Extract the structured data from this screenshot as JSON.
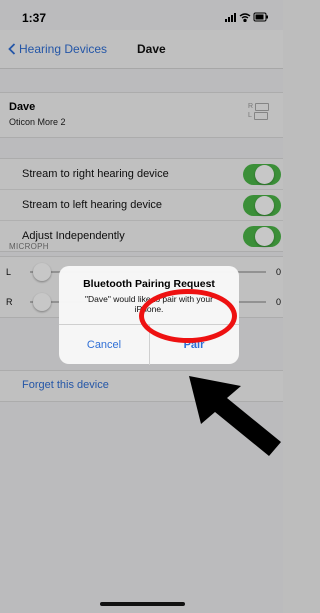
{
  "status_bar": {
    "time": "1:37"
  },
  "nav": {
    "back_label": "Hearing Devices",
    "title": "Dave"
  },
  "device": {
    "name": "Dave",
    "model": "Oticon More 2",
    "right_label": "R",
    "left_label": "L"
  },
  "toggles": [
    {
      "label": "Stream to right hearing device",
      "on": true
    },
    {
      "label": "Stream to left hearing device",
      "on": true
    },
    {
      "label": "Adjust Independently",
      "on": true
    }
  ],
  "mic": {
    "section_label": "MICROPH",
    "rows": [
      {
        "label": "L",
        "value": "0"
      },
      {
        "label": "R",
        "value": "0"
      }
    ]
  },
  "forget_label": "Forget this device",
  "alert": {
    "title": "Bluetooth Pairing Request",
    "message": "\"Dave\" would like to pair with your iPhone.",
    "cancel_label": "Cancel",
    "pair_label": "Pair"
  },
  "colors": {
    "accent": "#2f6fd6",
    "toggle_on": "#4cb848",
    "annotation": "#e11111"
  }
}
